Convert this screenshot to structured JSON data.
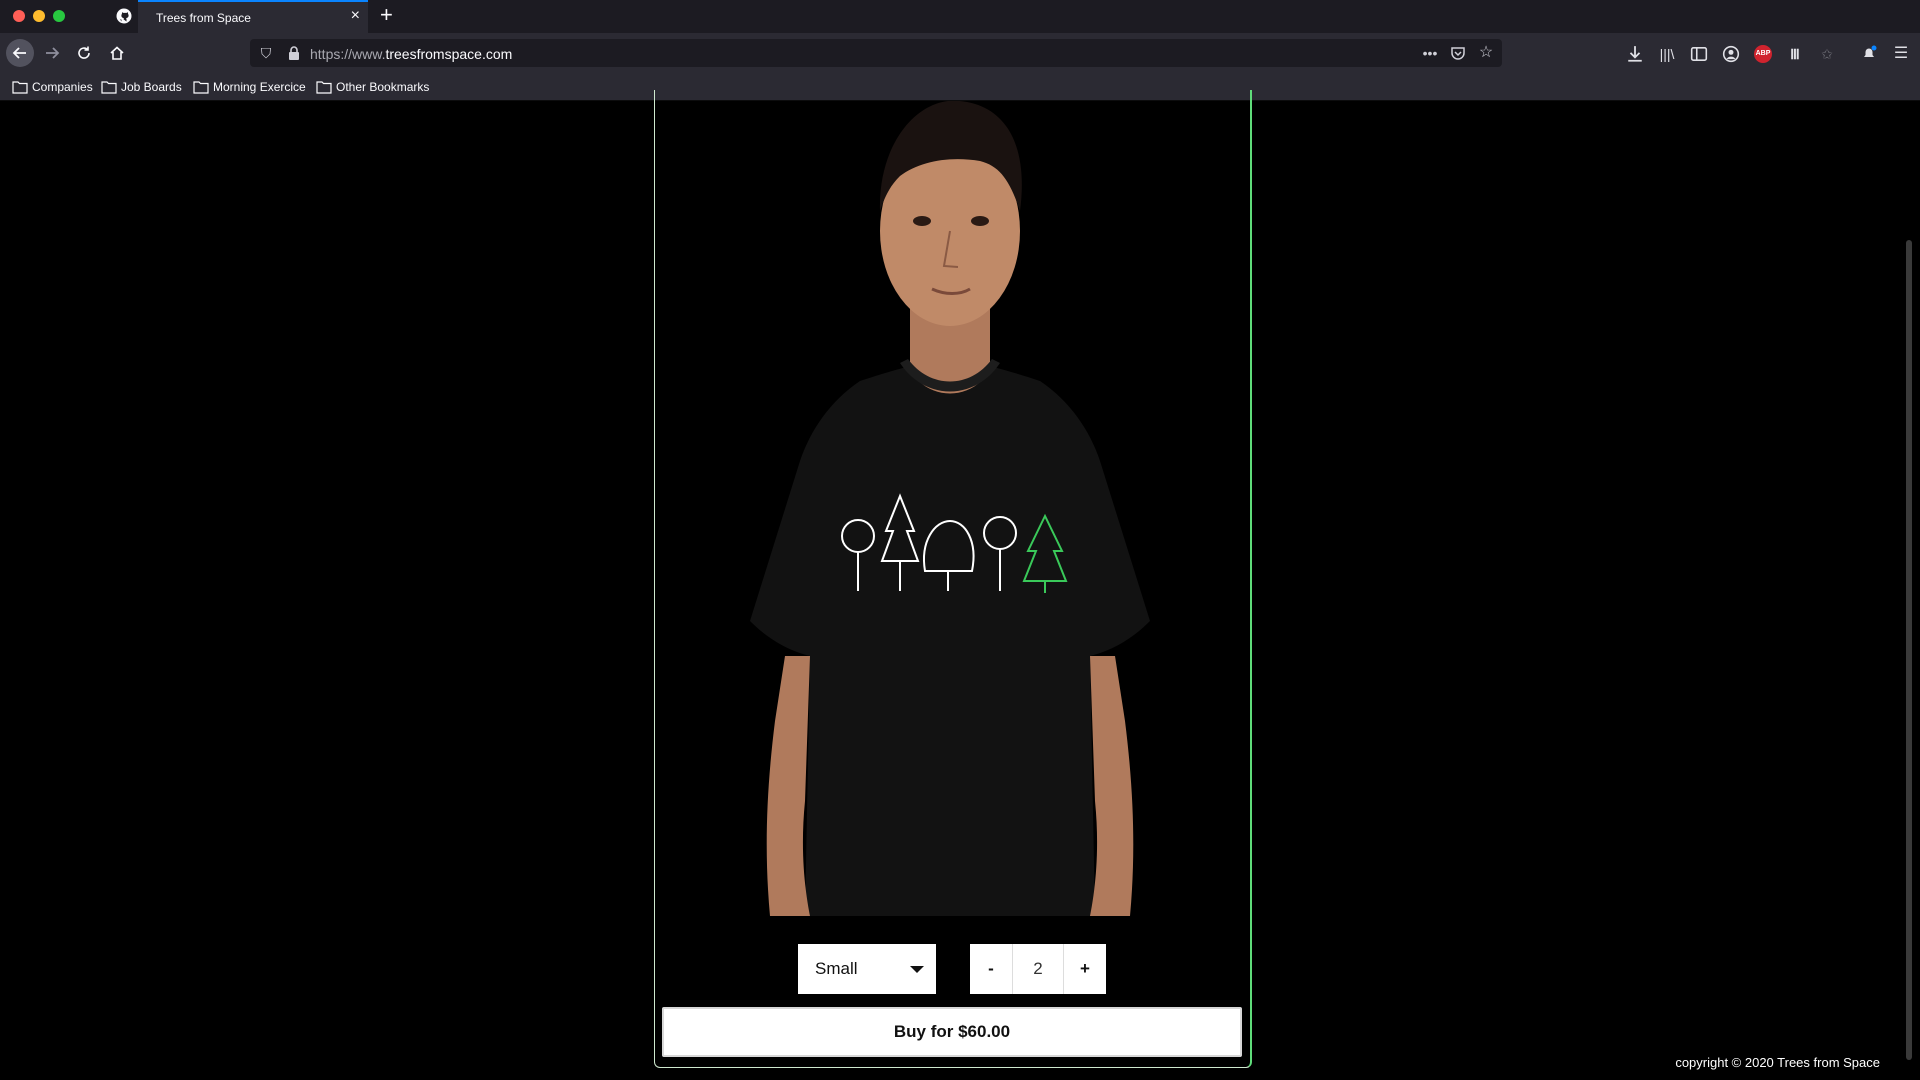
{
  "browser": {
    "tab_title": "Trees from Space",
    "tab_icon": "github-icon",
    "url_prefix": "https://www.",
    "url_domain": "treesfromspace.com",
    "bookmarks": [
      "Companies",
      "Job Boards",
      "Morning Exercice",
      "Other Bookmarks"
    ],
    "adblock_label": "ABP",
    "accent_color": "#0a84ff"
  },
  "product": {
    "size_selected": "Small",
    "quantity": "2",
    "decrement_label": "-",
    "increment_label": "+",
    "buy_label": "Buy for $60.00",
    "border_color": "#5fdc7a"
  },
  "footer": {
    "copyright": "copyright © 2020 Trees from Space"
  }
}
